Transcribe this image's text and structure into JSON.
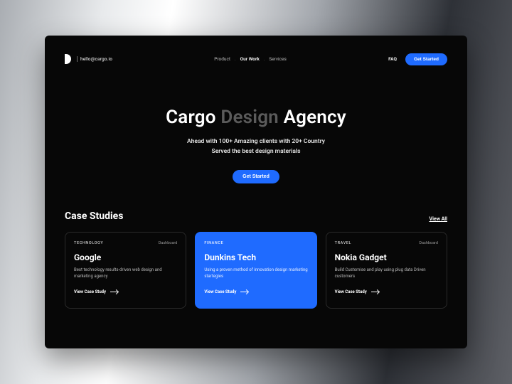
{
  "header": {
    "email": "hello@cargo.io",
    "nav": {
      "product": "Product",
      "work": "Our Work",
      "services": "Services"
    },
    "faq": "FAQ",
    "cta": "Get Started"
  },
  "hero": {
    "title_a": "Cargo ",
    "title_b": "Design",
    "title_c": " Agency",
    "sub1": "Ahead with 100+ Amazing clients with 20+ Country",
    "sub2": "Served the best design materials",
    "cta": "Get Started"
  },
  "section": {
    "title": "Case Studies",
    "view_all": "View All"
  },
  "cards": [
    {
      "cat": "TECHNOLOGY",
      "tag": "Dashboard",
      "title": "Google",
      "desc": "Best technology results-driven web design and marketing agency",
      "link": "View Case Study"
    },
    {
      "cat": "FINANCE",
      "tag": "",
      "title": "Dunkins Tech",
      "desc": "Using a proven method of innovation design marketing startegies",
      "link": "View Case Study"
    },
    {
      "cat": "TRAVEL",
      "tag": "Dashboard",
      "title": "Nokia Gadget",
      "desc": "Build Customise and play using plug data Driven customers",
      "link": "View Case Study"
    }
  ]
}
